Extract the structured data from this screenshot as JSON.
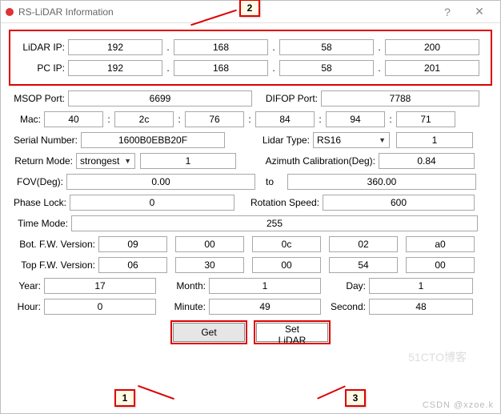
{
  "window": {
    "title": "RS-LiDAR Information"
  },
  "callouts": {
    "c1": "1",
    "c2": "2",
    "c3": "3"
  },
  "ip": {
    "lidar_label": "LiDAR IP:",
    "pc_label": "PC IP:",
    "dot": ".",
    "lidar": [
      "192",
      "168",
      "58",
      "200"
    ],
    "pc": [
      "192",
      "168",
      "58",
      "201"
    ]
  },
  "ports": {
    "msop_label": "MSOP Port:",
    "msop": "6699",
    "difop_label": "DIFOP Port:",
    "difop": "7788"
  },
  "mac": {
    "label": "Mac:",
    "colon": ":",
    "vals": [
      "40",
      "2c",
      "76",
      "84",
      "94",
      "71"
    ]
  },
  "serial": {
    "label": "Serial Number:",
    "value": "1600B0EBB20F"
  },
  "lidar_type": {
    "label": "Lidar Type:",
    "selected": "RS16",
    "num": "1"
  },
  "return_mode": {
    "label": "Return Mode:",
    "selected": "strongest",
    "num": "1"
  },
  "azimuth": {
    "label": "Azimuth Calibration(Deg):",
    "value": "0.84"
  },
  "fov": {
    "label": "FOV(Deg):",
    "from": "0.00",
    "to_label": "to",
    "to": "360.00"
  },
  "phase": {
    "label": "Phase Lock:",
    "value": "0"
  },
  "rotation": {
    "label": "Rotation Speed:",
    "value": "600"
  },
  "time_mode": {
    "label": "Time Mode:",
    "value": "255"
  },
  "bot_fw": {
    "label": "Bot. F.W. Version:",
    "vals": [
      "09",
      "00",
      "0c",
      "02",
      "a0"
    ]
  },
  "top_fw": {
    "label": "Top  F.W. Version:",
    "vals": [
      "06",
      "30",
      "00",
      "54",
      "00"
    ]
  },
  "date": {
    "year_l": "Year:",
    "year": "17",
    "month_l": "Month:",
    "month": "1",
    "day_l": "Day:",
    "day": "1",
    "hour_l": "Hour:",
    "hour": "0",
    "minute_l": "Minute:",
    "minute": "49",
    "second_l": "Second:",
    "second": "48"
  },
  "buttons": {
    "get": "Get",
    "set": "Set LiDAR"
  },
  "watermark": "CSDN @xzoe.k"
}
